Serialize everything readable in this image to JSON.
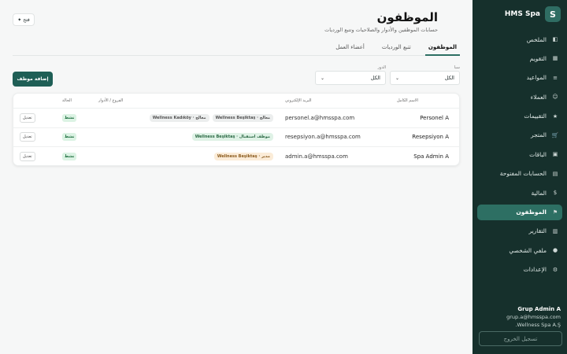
{
  "sidebar": {
    "brand_logo": "S",
    "brand_name": "HMS Spa",
    "items": [
      {
        "label": "الملخص",
        "icon": "◧"
      },
      {
        "label": "التقويم",
        "icon": "▦"
      },
      {
        "label": "المواعيد",
        "icon": "≡"
      },
      {
        "label": "العملاء",
        "icon": "☺"
      },
      {
        "label": "التقييمات",
        "icon": "★"
      },
      {
        "label": "المتجر",
        "icon": "🛒"
      },
      {
        "label": "الباقات",
        "icon": "▣"
      },
      {
        "label": "الحسابات المفتوحة",
        "icon": "▤"
      },
      {
        "label": "المالية",
        "icon": "$"
      },
      {
        "label": "الموظفون",
        "icon": "⚑",
        "active": true
      },
      {
        "label": "التقارير",
        "icon": "▥"
      },
      {
        "label": "ملفي الشخصي",
        "icon": "●"
      },
      {
        "label": "الإعدادات",
        "icon": "⚙"
      }
    ],
    "user": {
      "name": "Grup Admin A",
      "email": "grup.a@hmsspa.com",
      "company": "Wellness Spa A.Ş."
    },
    "logout_label": "تسجيل الخروج"
  },
  "header": {
    "title": "الموظفون",
    "subtitle": "حسابات الموظفين والأدوار والصلاحيات وتتبع الورديات",
    "open_label": "فتح"
  },
  "tabs": [
    {
      "label": "الموظفون",
      "active": true
    },
    {
      "label": "تتبع الورديات"
    },
    {
      "label": "أعضاء العمل"
    }
  ],
  "filters": {
    "spa_label": "سبا",
    "spa_value": "الكل",
    "role_label": "الدور",
    "role_value": "الكل"
  },
  "add_button_label": "إضافة موظف",
  "table": {
    "headers": {
      "name": "الاسم الكامل",
      "email": "البريد الإلكتروني",
      "roles": "الفروع / الأدوار",
      "status": "الحالة"
    },
    "rows": [
      {
        "name": "Personel A",
        "email": "personel.a@hmsspa.com",
        "roles": [
          {
            "text": "Wellness Beşiktaş · معالج",
            "style": "gray"
          },
          {
            "text": "Wellness Kadıköy · معالج",
            "style": "gray"
          }
        ],
        "status": "نشط",
        "edit": "تعديل"
      },
      {
        "name": "Resepsiyon A",
        "email": "resepsiyon.a@hmsspa.com",
        "roles": [
          {
            "text": "Wellness Beşiktaş · موظف استقبال",
            "style": "green"
          }
        ],
        "status": "نشط",
        "edit": "تعديل"
      },
      {
        "name": "Spa Admin A",
        "email": "admin.a@hmsspa.com",
        "roles": [
          {
            "text": "Wellness Beşiktaş · مدير",
            "style": "orange"
          }
        ],
        "status": "نشط",
        "edit": "تعديل"
      }
    ]
  },
  "colors": {
    "sidebar_bg": "#16302c",
    "accent": "#2d6f63",
    "primary_button": "#1f5f56"
  }
}
